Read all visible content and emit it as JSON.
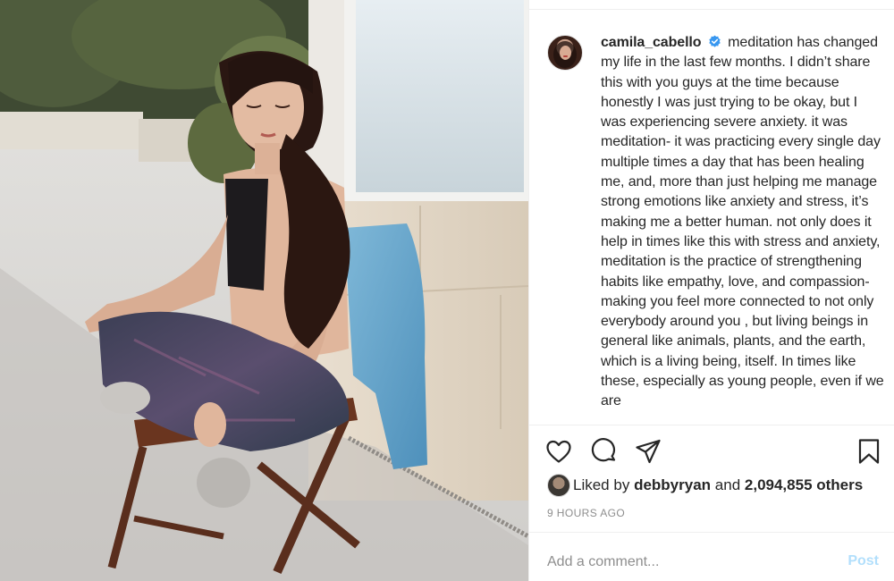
{
  "post": {
    "username": "camila_cabello",
    "caption": "meditation has changed my life in the last few months. I didn’t share this with you guys at the time because honestly I was just trying to be okay, but I was experiencing severe anxiety. it was meditation- it was practicing every single day multiple times a day that has been healing me, and, more than just helping me manage strong emotions like anxiety and stress, it’s making me a better human. not only does it help in times like this with stress and anxiety, meditation is the practice of strengthening habits like empathy, love, and compassion- making you feel more connected to not only everybody around you , but living beings in general like animals, plants, and the earth, which is a living being, itself. In times like these, especially as young people, even if we are",
    "liked_by_prefix": "Liked by",
    "liked_by_user": "debbyryan",
    "liked_by_and": "and",
    "likes_others": "2,094,855 others",
    "timestamp": "9 HOURS AGO"
  },
  "comment": {
    "placeholder": "Add a comment...",
    "post_label": "Post"
  },
  "icons": {
    "verified": "verified-badge-icon",
    "like": "heart-icon",
    "comment": "speech-bubble-icon",
    "share": "paper-plane-icon",
    "save": "bookmark-icon"
  },
  "colors": {
    "verified_blue": "#3897f0",
    "post_button_disabled": "#b2dffc",
    "timestamp_gray": "#8e8e8e"
  }
}
